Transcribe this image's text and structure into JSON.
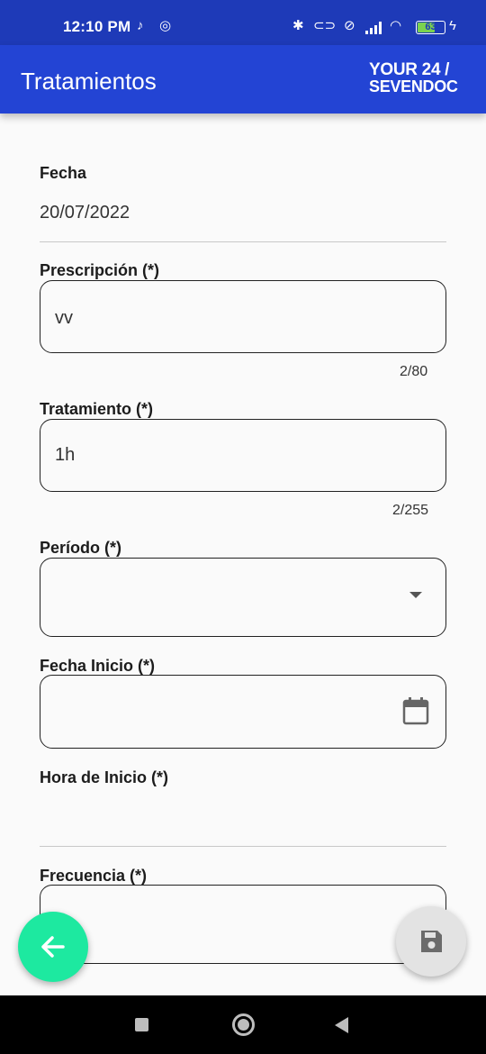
{
  "status_bar": {
    "time": "12:10 PM",
    "battery_level": "63",
    "battery_percent": 63,
    "icons": [
      "tiktok-icon",
      "at-icon",
      "bluetooth-icon",
      "toggle-icon",
      "alarm-off-icon",
      "signal-icon",
      "wifi-icon",
      "battery-icon",
      "charging-icon"
    ]
  },
  "app_bar": {
    "title": "Tratamientos",
    "logo_line1": "YOUR 24 /",
    "logo_line2": "SEVENDOC"
  },
  "form": {
    "fecha": {
      "label": "Fecha",
      "value": "20/07/2022"
    },
    "prescripcion": {
      "label": "Prescripción (*)",
      "value": "vv",
      "counter": "2/80"
    },
    "tratamiento": {
      "label": "Tratamiento (*)",
      "value": "1h",
      "counter": "2/255"
    },
    "periodo": {
      "label": "Período (*)",
      "value": ""
    },
    "fecha_inicio": {
      "label": "Fecha Inicio (*)",
      "value": ""
    },
    "hora_inicio": {
      "label": "Hora de Inicio (*)",
      "value": ""
    },
    "frecuencia": {
      "label": "Frecuencia (*)",
      "value": ""
    }
  },
  "colors": {
    "status_bar": "#1e3ab8",
    "app_bar": "#2344d4",
    "fab_back": "#1de9a0",
    "fab_save": "#e3e3e3"
  }
}
